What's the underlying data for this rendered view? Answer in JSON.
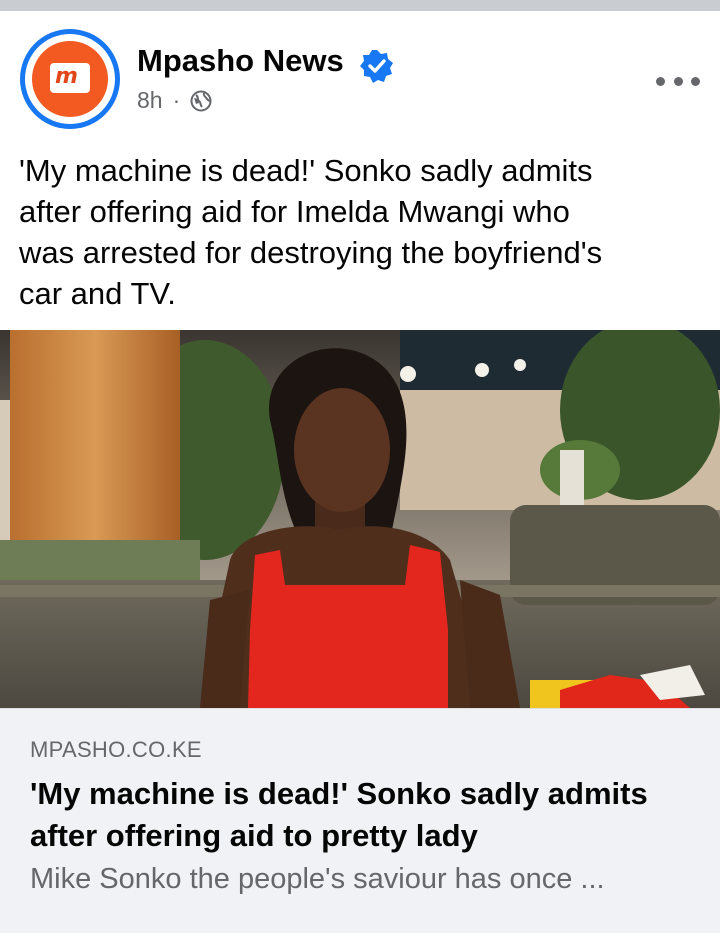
{
  "post": {
    "page_name": "Mpasho News",
    "verified_icon": "verified-badge-icon",
    "time": "8h",
    "separator": "·",
    "audience_icon": "globe-icon",
    "more_icon": "more-options-icon",
    "text_lines": [
      "'My machine is dead!' Sonko sadly admits",
      "after offering aid for Imelda Mwangi who",
      "was arrested for destroying the boyfriend's",
      "car and TV."
    ]
  },
  "avatar": {
    "logo_text": "m",
    "ring_color": "#1877f2",
    "brand_color": "#f25a22"
  },
  "link_preview": {
    "domain": "MPASHO.CO.KE",
    "title_lines": [
      "'My machine is dead!' Sonko sadly admits",
      "after offering aid to pretty lady"
    ],
    "description": "Mike Sonko the people's saviour has once ..."
  },
  "colors": {
    "accent": "#1877f2",
    "text_primary": "#050505",
    "text_secondary": "#65676b",
    "card_bg": "#f0f2f5"
  }
}
